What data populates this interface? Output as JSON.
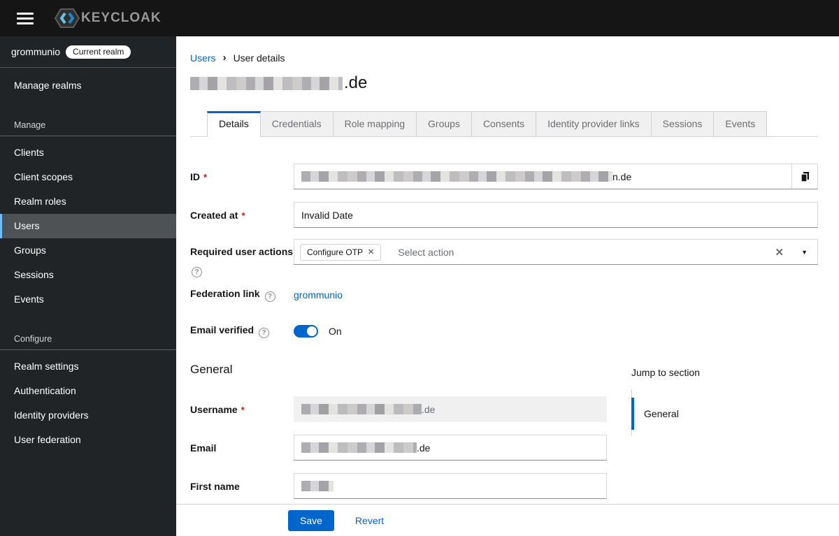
{
  "masthead": {
    "brand_text": "KEYCLOAK"
  },
  "icons": {
    "menu": "hamburger-bars",
    "breadcrumb_separator": "›",
    "remove_chip": "✕",
    "clear": "✕",
    "caret_down": "▼",
    "help": "?",
    "copy": "copy-pages"
  },
  "colors": {
    "accent_blue": "#0066cc",
    "masthead_bg": "#151515",
    "sidebar_bg": "#212427",
    "sidebar_active_bg": "#4f5255",
    "sidebar_active_border": "#73bcf7",
    "required_red": "#c9190b",
    "logo_chevron_light": "#62c5e9",
    "logo_chevron_dark": "#1e87c9"
  },
  "sidebar": {
    "realm": {
      "name": "grommunio",
      "badge": "Current realm"
    },
    "manage_realms_label": "Manage realms",
    "sections": [
      {
        "title": "Manage",
        "active_item": "Users",
        "items": [
          "Clients",
          "Client scopes",
          "Realm roles",
          "Users",
          "Groups",
          "Sessions",
          "Events"
        ]
      },
      {
        "title": "Configure",
        "items": [
          "Realm settings",
          "Authentication",
          "Identity providers",
          "User federation"
        ]
      }
    ]
  },
  "breadcrumb": {
    "parent": "Users",
    "current": "User details"
  },
  "page": {
    "title_redacted": true,
    "title_suffix": ".de"
  },
  "tabs": {
    "active": "Details",
    "items": [
      "Details",
      "Credentials",
      "Role mapping",
      "Groups",
      "Consents",
      "Identity provider links",
      "Sessions",
      "Events"
    ]
  },
  "form": {
    "required_marker": "*",
    "id": {
      "label": "ID",
      "required": true,
      "value_redacted": true,
      "value_suffix": "n.de"
    },
    "created_at": {
      "label": "Created at",
      "required": true,
      "value": "Invalid Date"
    },
    "required_user_actions": {
      "label": "Required user actions",
      "chips": [
        "Configure OTP"
      ],
      "placeholder": "Select action"
    },
    "federation_link": {
      "label": "Federation link",
      "value": "grommunio"
    },
    "email_verified": {
      "label": "Email verified",
      "enabled": true,
      "state_label": "On"
    }
  },
  "general": {
    "heading": "General",
    "username": {
      "label": "Username",
      "required": true,
      "disabled": true,
      "value_redacted": true,
      "value_suffix": ".de"
    },
    "email": {
      "label": "Email",
      "value_redacted": true,
      "value_suffix": ".de"
    },
    "first_name": {
      "label": "First name",
      "value_redacted": true
    }
  },
  "jump_links": {
    "heading": "Jump to section",
    "active": "General",
    "items": [
      "General"
    ]
  },
  "actions": {
    "save": "Save",
    "revert": "Revert"
  }
}
